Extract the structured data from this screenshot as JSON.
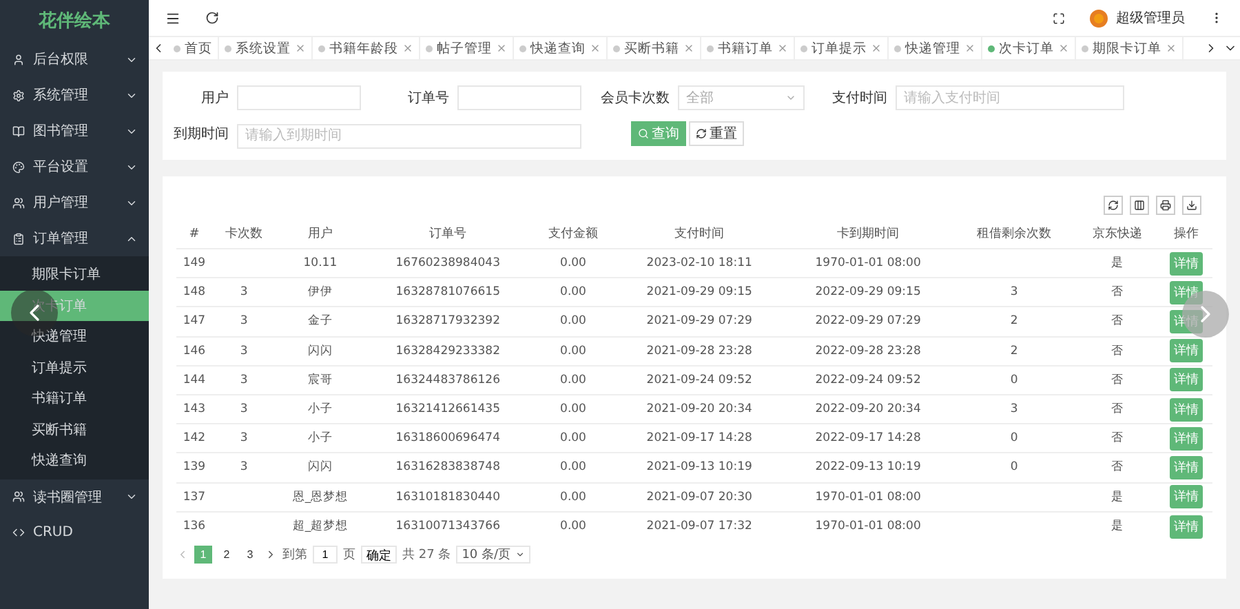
{
  "sidebar": {
    "logo": "花伴绘本",
    "items": [
      {
        "label": "后台权限",
        "expanded": false
      },
      {
        "label": "系统管理",
        "expanded": false
      },
      {
        "label": "图书管理",
        "expanded": false
      },
      {
        "label": "平台设置",
        "expanded": false
      },
      {
        "label": "用户管理",
        "expanded": false
      },
      {
        "label": "订单管理",
        "expanded": true,
        "children": [
          {
            "label": "期限卡订单",
            "selected": false
          },
          {
            "label": "次卡订单",
            "selected": true
          },
          {
            "label": "快递管理",
            "selected": false
          },
          {
            "label": "订单提示",
            "selected": false
          },
          {
            "label": "书籍订单",
            "selected": false
          },
          {
            "label": "买断书籍",
            "selected": false
          },
          {
            "label": "快递查询",
            "selected": false
          }
        ]
      },
      {
        "label": "读书圈管理",
        "expanded": false
      },
      {
        "label": "CRUD"
      }
    ]
  },
  "header": {
    "user": "超级管理员"
  },
  "tabs": [
    {
      "label": "首页",
      "selected": false,
      "closable": false
    },
    {
      "label": "系统设置",
      "selected": false,
      "closable": true
    },
    {
      "label": "书籍年龄段",
      "selected": false,
      "closable": true
    },
    {
      "label": "帖子管理",
      "selected": false,
      "closable": true
    },
    {
      "label": "快递查询",
      "selected": false,
      "closable": true
    },
    {
      "label": "买断书籍",
      "selected": false,
      "closable": true
    },
    {
      "label": "书籍订单",
      "selected": false,
      "closable": true
    },
    {
      "label": "订单提示",
      "selected": false,
      "closable": true
    },
    {
      "label": "快递管理",
      "selected": false,
      "closable": true
    },
    {
      "label": "次卡订单",
      "selected": true,
      "closable": true
    },
    {
      "label": "期限卡订单",
      "selected": false,
      "closable": true
    }
  ],
  "filters": {
    "user": {
      "label": "用户"
    },
    "order_no": {
      "label": "订单号"
    },
    "card_times": {
      "label": "会员卡次数",
      "value": "全部"
    },
    "pay_time": {
      "label": "支付时间",
      "placeholder": "请输入支付时间"
    },
    "expire_time": {
      "label": "到期时间",
      "placeholder": "请输入到期时间"
    },
    "search_button": "查询",
    "reset_button": "重置"
  },
  "table": {
    "columns": [
      "#",
      "卡次数",
      "用户",
      "订单号",
      "支付金额",
      "支付时间",
      "卡到期时间",
      "租借剩余次数",
      "京东快递",
      "操作"
    ],
    "rows": [
      [
        "149",
        "",
        "10.11",
        "16760238984043",
        "0.00",
        "2023-02-10 18:11",
        "1970-01-01 08:00",
        "",
        "是",
        "详情"
      ],
      [
        "148",
        "3",
        "伊伊",
        "16328781076615",
        "0.00",
        "2021-09-29 09:15",
        "2022-09-29 09:15",
        "3",
        "否",
        "详情"
      ],
      [
        "147",
        "3",
        "金子",
        "16328717932392",
        "0.00",
        "2021-09-29 07:29",
        "2022-09-29 07:29",
        "2",
        "否",
        "详情"
      ],
      [
        "146",
        "3",
        "闪闪",
        "16328429233382",
        "0.00",
        "2021-09-28 23:28",
        "2022-09-28 23:28",
        "2",
        "否",
        "详情"
      ],
      [
        "144",
        "3",
        "宸哥",
        "16324483786126",
        "0.00",
        "2021-09-24 09:52",
        "2022-09-24 09:52",
        "0",
        "否",
        "详情"
      ],
      [
        "143",
        "3",
        "小子",
        "16321412661435",
        "0.00",
        "2021-09-20 20:34",
        "2022-09-20 20:34",
        "3",
        "否",
        "详情"
      ],
      [
        "142",
        "3",
        "小子",
        "16318600696474",
        "0.00",
        "2021-09-17 14:28",
        "2022-09-17 14:28",
        "0",
        "否",
        "详情"
      ],
      [
        "139",
        "3",
        "闪闪",
        "16316283838748",
        "0.00",
        "2021-09-13 10:19",
        "2022-09-13 10:19",
        "0",
        "否",
        "详情"
      ],
      [
        "137",
        "",
        "恩_恩梦想",
        "16310181830440",
        "0.00",
        "2021-09-07 20:30",
        "1970-01-01 08:00",
        "",
        "是",
        "详情"
      ],
      [
        "136",
        "",
        "超_超梦想",
        "16310071343766",
        "0.00",
        "2021-09-07 17:32",
        "1970-01-01 08:00",
        "",
        "是",
        "详情"
      ]
    ]
  },
  "pagination": {
    "pages": [
      {
        "label": "1",
        "selected": true
      },
      {
        "label": "2",
        "selected": false
      },
      {
        "label": "3",
        "selected": false
      }
    ],
    "goto_label": "到第",
    "goto_value": "1",
    "page_unit": "页",
    "confirm": "确定",
    "total": "共 27 条",
    "page_size": "10 条/页"
  }
}
